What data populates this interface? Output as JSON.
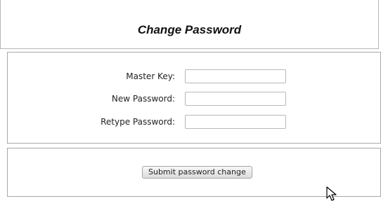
{
  "header": {
    "title": "Change Password"
  },
  "form": {
    "fields": [
      {
        "label": "Master Key:",
        "value": ""
      },
      {
        "label": "New Password:",
        "value": ""
      },
      {
        "label": "Retype Password:",
        "value": ""
      }
    ],
    "submit_label": "Submit password change"
  },
  "colors": {
    "border": "#a8a8a8",
    "button_bg": "#e6e6e6"
  },
  "icons": {
    "pointer": "mouse-pointer-icon"
  }
}
